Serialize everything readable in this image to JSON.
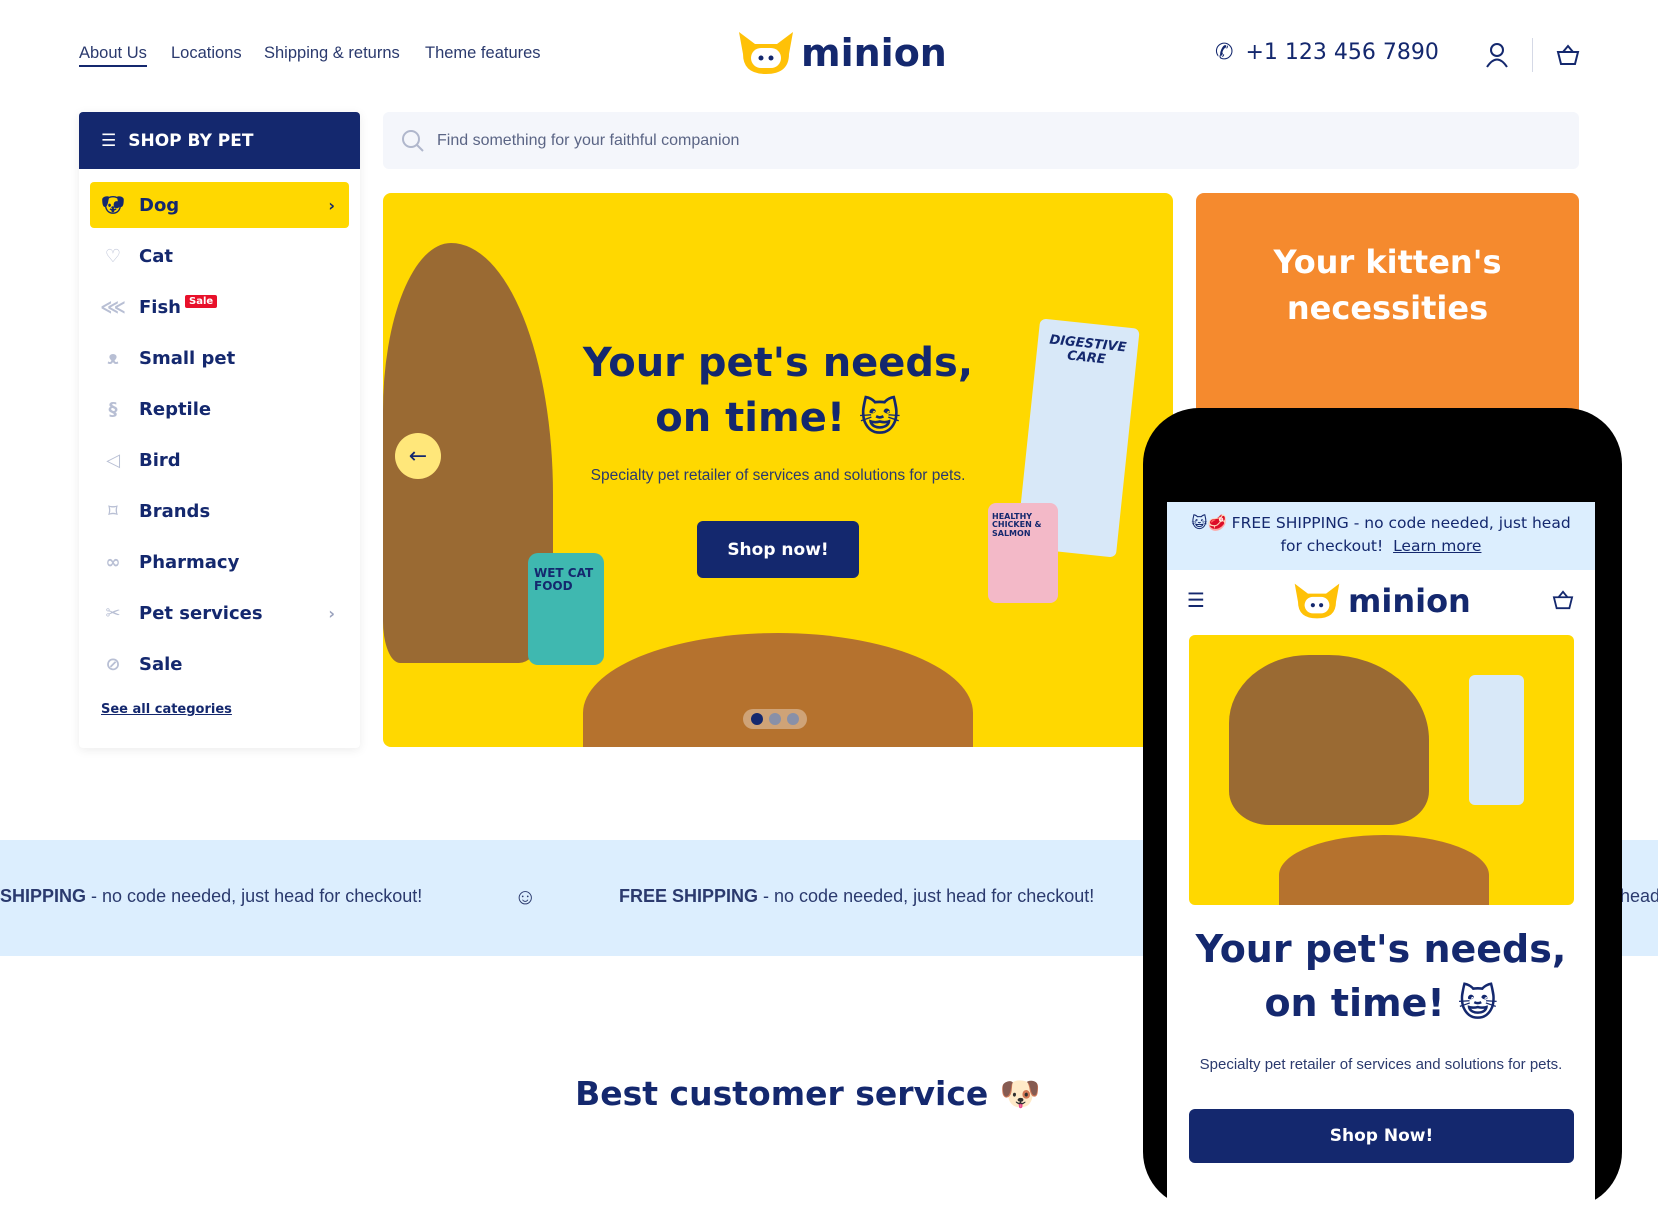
{
  "nav": {
    "links": [
      "About Us",
      "Locations",
      "Shipping & returns",
      "Theme features"
    ],
    "active": "About Us"
  },
  "brand": {
    "name": "minion",
    "color": "#14286e",
    "accent": "#ffd800"
  },
  "header": {
    "phone": "+1 123 456 7890",
    "icons": [
      "phone-icon",
      "user-icon",
      "basket-icon"
    ]
  },
  "sidebar": {
    "title": "SHOP BY PET",
    "items": [
      {
        "label": "Dog",
        "icon": "dog-icon",
        "selected": true,
        "chevron": true
      },
      {
        "label": "Cat",
        "icon": "cat-icon"
      },
      {
        "label": "Fish",
        "icon": "fish-icon",
        "badge": "Sale"
      },
      {
        "label": "Small pet",
        "icon": "small-pet-icon"
      },
      {
        "label": "Reptile",
        "icon": "reptile-icon"
      },
      {
        "label": "Bird",
        "icon": "bird-icon"
      },
      {
        "label": "Brands",
        "icon": "bookmark-icon"
      },
      {
        "label": "Pharmacy",
        "icon": "pills-icon"
      },
      {
        "label": "Pet services",
        "icon": "grooming-icon",
        "chevron": true
      },
      {
        "label": "Sale",
        "icon": "sale-icon"
      }
    ],
    "see_all": "See all categories"
  },
  "search": {
    "placeholder": "Find something for your faithful companion"
  },
  "hero": {
    "title1": "Your pet's needs,",
    "title2": "on time! 😺",
    "subtitle": "Specialty pet retailer of services and solutions for pets.",
    "button": "Shop now!",
    "slides": 3,
    "active_slide": 1,
    "product1": "WET CAT FOOD",
    "product2": "DIGESTIVE CARE",
    "product3": "HEALTHY CHICKEN & SALMON"
  },
  "promo": {
    "title": "Your kitten's necessities",
    "color": "#f58a2e"
  },
  "marquee": {
    "bold": "FREE SHIPPING",
    "bold_partial": "SHIPPING",
    "text": " - no code needed, just head for checkout!",
    "tail": "head"
  },
  "section": {
    "title": "Best customer service 🐶"
  },
  "mobile": {
    "announcement": "😺🥩 FREE SHIPPING - no code needed, just head for checkout!",
    "learn_more": "Learn more",
    "title1": "Your pet's needs,",
    "title2": "on time! 😺",
    "subtitle": "Specialty pet retailer of services and solutions for pets.",
    "button": "Shop Now!"
  }
}
